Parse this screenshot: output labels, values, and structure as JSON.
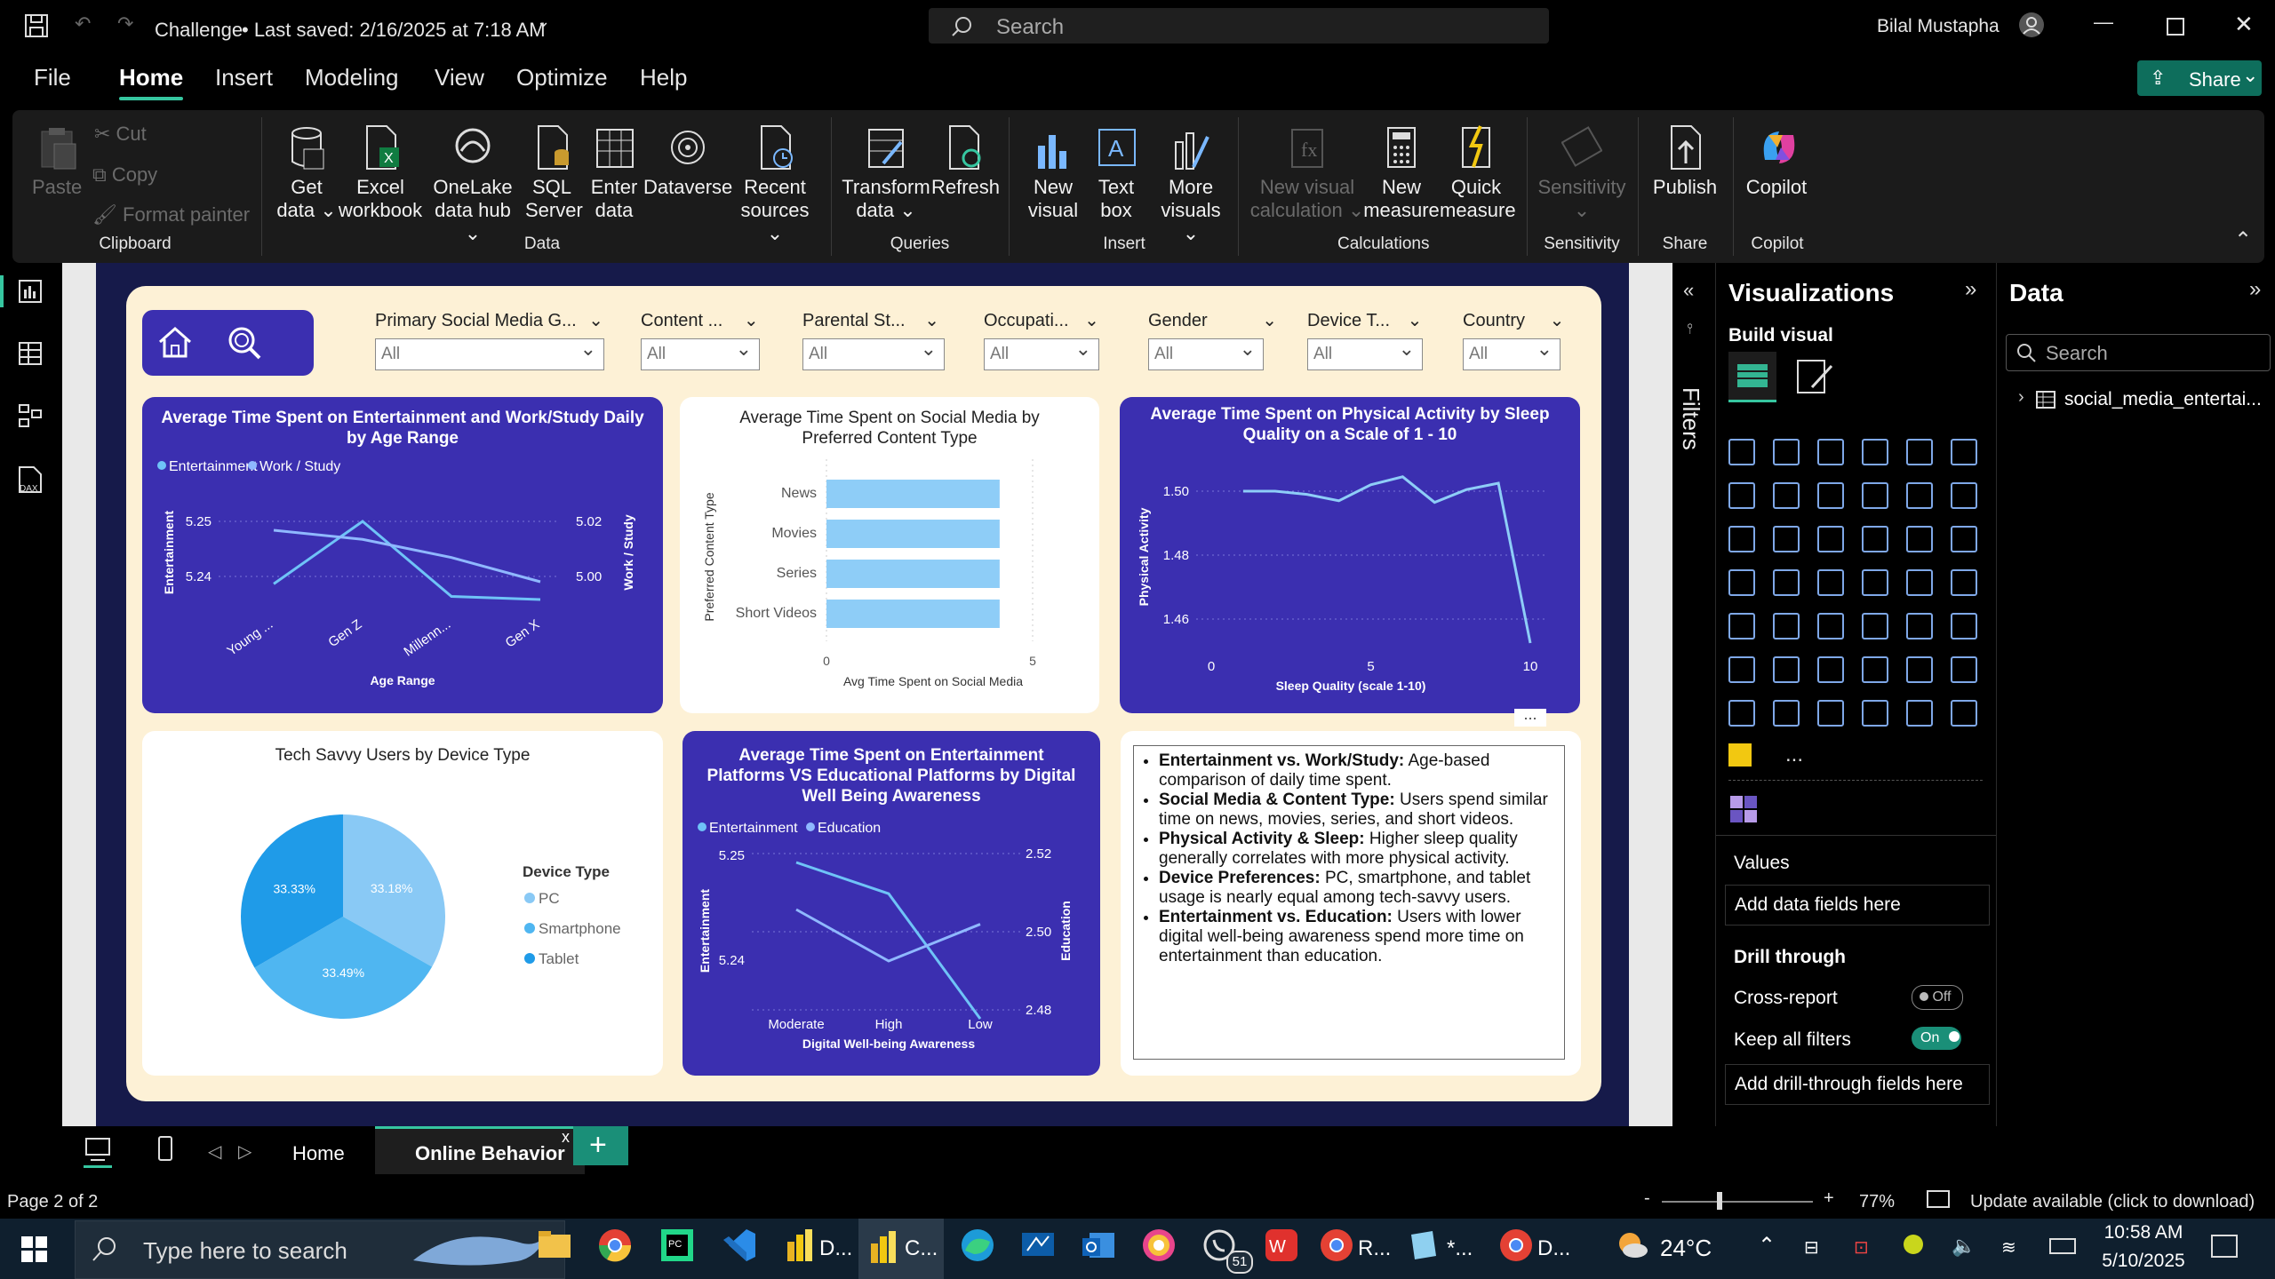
{
  "window": {
    "title": "Challenge",
    "saved": "• Last saved: 2/16/2025 at 7:18 AM",
    "search_placeholder": "Search",
    "user": "Bilal Mustapha"
  },
  "menu": [
    "File",
    "Home",
    "Insert",
    "Modeling",
    "View",
    "Optimize",
    "Help"
  ],
  "share_label": "Share",
  "ribbon": {
    "clipboard": {
      "paste": "Paste",
      "cut": "Cut",
      "copy": "Copy",
      "format_painter": "Format painter",
      "group": "Clipboard"
    },
    "data": {
      "get_data": [
        "Get",
        "data"
      ],
      "excel": [
        "Excel",
        "workbook"
      ],
      "onelake": [
        "OneLake",
        "data hub"
      ],
      "sql": [
        "SQL",
        "Server"
      ],
      "enter": [
        "Enter",
        "data"
      ],
      "dataverse": "Dataverse",
      "recent": [
        "Recent",
        "sources"
      ],
      "group": "Data"
    },
    "queries": {
      "transform": [
        "Transform",
        "data"
      ],
      "refresh": "Refresh",
      "group": "Queries"
    },
    "insert": {
      "new_visual": [
        "New",
        "visual"
      ],
      "text_box": [
        "Text",
        "box"
      ],
      "more_visuals": [
        "More",
        "visuals"
      ],
      "group": "Insert"
    },
    "calculations": {
      "new_visual_calc": [
        "New visual",
        "calculation"
      ],
      "new_measure": [
        "New",
        "measure"
      ],
      "quick_measure": [
        "Quick",
        "measure"
      ],
      "group": "Calculations"
    },
    "sensitivity": {
      "label": "Sensitivity",
      "group": "Sensitivity"
    },
    "share": {
      "publish": "Publish",
      "group": "Share"
    },
    "copilot": {
      "label": "Copilot",
      "group": "Copilot"
    }
  },
  "slicers": [
    {
      "label": "Primary Social Media G...",
      "value": "All"
    },
    {
      "label": "Content ...",
      "value": "All"
    },
    {
      "label": "Parental St...",
      "value": "All"
    },
    {
      "label": "Occupati...",
      "value": "All"
    },
    {
      "label": "Gender",
      "value": "All"
    },
    {
      "label": "Device T...",
      "value": "All"
    },
    {
      "label": "Country",
      "value": "All"
    }
  ],
  "chart_data": [
    {
      "type": "line",
      "title": "Average Time Spent on Entertainment and Work/Study Daily by Age Range",
      "x": [
        "Young ...",
        "Gen Z",
        "Millenn...",
        "Gen X"
      ],
      "series": [
        {
          "name": "Entertainment",
          "axis": "left",
          "values": [
            5.242,
            5.252,
            5.24,
            5.2395
          ]
        },
        {
          "name": "Work / Study",
          "axis": "right",
          "values": [
            5.018,
            5.015,
            5.009,
            5.001
          ]
        }
      ],
      "xlabel": "Age Range",
      "ylabel": "Entertainment",
      "ylabel_right": "Work / Study",
      "ylim": [
        5.235,
        5.255
      ],
      "ylim_right": [
        4.99,
        5.03
      ],
      "yticks": [
        "5.25",
        "5.24"
      ],
      "yticks_right": [
        "5.02",
        "5.00"
      ],
      "colors": {
        "Entertainment": "#6fc3f7",
        "Work / Study": "#8fb8ff"
      }
    },
    {
      "type": "bar",
      "title": "Average Time Spent on Social Media by Preferred Content Type",
      "categories": [
        "News",
        "Movies",
        "Series",
        "Short Videos"
      ],
      "values": [
        4.2,
        4.2,
        4.2,
        4.2
      ],
      "xlabel": "Avg Time Spent on Social Media",
      "ylabel": "Preferred Content Type",
      "xlim": [
        0,
        5
      ],
      "xticks": [
        "0",
        "5"
      ],
      "color": "#8ecdf7"
    },
    {
      "type": "line",
      "title": "Average Time Spent on Physical Activity by Sleep Quality on a Scale of 1 - 10",
      "x": [
        1,
        2,
        3,
        4,
        5,
        6,
        7,
        8,
        9,
        10
      ],
      "values": [
        1.5,
        1.5,
        1.499,
        1.497,
        1.502,
        1.5045,
        1.4965,
        1.5005,
        1.5025,
        1.4525
      ],
      "xlabel": "Sleep Quality (scale 1-10)",
      "ylabel": "Physical Activity",
      "ylim": [
        1.45,
        1.51
      ],
      "yticks": [
        "1.50",
        "1.48",
        "1.46"
      ],
      "xticks": [
        "0",
        "5",
        "10"
      ],
      "color": "#8ecdf7"
    },
    {
      "type": "pie",
      "title": "Tech Savvy Users by Device Type",
      "legend_title": "Device Type",
      "labels": [
        "PC",
        "Smartphone",
        "Tablet"
      ],
      "values": [
        33.18,
        33.49,
        33.33
      ],
      "value_labels": [
        "33.18%",
        "33.49%",
        "33.33%"
      ],
      "colors": [
        "#89c9f5",
        "#4fb6f1",
        "#1f9be8"
      ]
    },
    {
      "type": "line",
      "title": "Average Time Spent on Entertainment Platforms VS Educational Platforms by Digital Well Being Awareness",
      "x": [
        "Moderate",
        "High",
        "Low"
      ],
      "series": [
        {
          "name": "Entertainment",
          "axis": "left",
          "values": [
            5.251,
            5.248,
            5.236
          ]
        },
        {
          "name": "Education",
          "axis": "right",
          "values": [
            2.506,
            2.492,
            2.502
          ]
        }
      ],
      "xlabel": "Digital Well-being Awareness",
      "ylabel": "Entertainment",
      "ylabel_right": "Education",
      "ylim": [
        5.232,
        5.255
      ],
      "ylim_right": [
        2.474,
        2.527
      ],
      "yticks": [
        "5.25",
        "5.24"
      ],
      "yticks_right": [
        "2.52",
        "2.50",
        "2.48"
      ],
      "colors": {
        "Entertainment": "#6fc3f7",
        "Education": "#8fb8ff"
      }
    }
  ],
  "insights": [
    {
      "head": "Entertainment vs. Work/Study:",
      "body": " Age-based comparison of daily time spent."
    },
    {
      "head": "Social Media & Content Type:",
      "body": " Users spend similar time on news, movies, series, and short videos."
    },
    {
      "head": "Physical Activity & Sleep:",
      "body": " Higher sleep quality generally correlates with more physical activity."
    },
    {
      "head": "Device Preferences:",
      "body": " PC, smartphone, and tablet usage is nearly equal among tech-savvy users."
    },
    {
      "head": "Entertainment vs. Education:",
      "body": " Users with lower digital well-being awareness spend more time on entertainment than education."
    }
  ],
  "filters_label": "Filters",
  "visualizations": {
    "title": "Visualizations",
    "build": "Build visual",
    "values": "Values",
    "add_fields": "Add data fields here",
    "drill": "Drill through",
    "cross": "Cross-report",
    "cross_state": "Off",
    "keep": "Keep all filters",
    "keep_state": "On",
    "drill_fields": "Add drill-through fields here",
    "more": "..."
  },
  "data_pane": {
    "title": "Data",
    "search_placeholder": "Search",
    "table": "social_media_entertai..."
  },
  "tabs": [
    "Home",
    "Online Behavior"
  ],
  "status": {
    "page": "Page 2 of 2",
    "zoom": "77%",
    "update": "Update available (click to download)"
  },
  "taskbar": {
    "search_placeholder": "Type here to search",
    "apps": [
      "D...",
      "C...",
      "R...",
      "*...",
      "D..."
    ],
    "badge": "51",
    "weather": "24°C",
    "time": "10:58 AM",
    "date": "5/10/2025"
  }
}
